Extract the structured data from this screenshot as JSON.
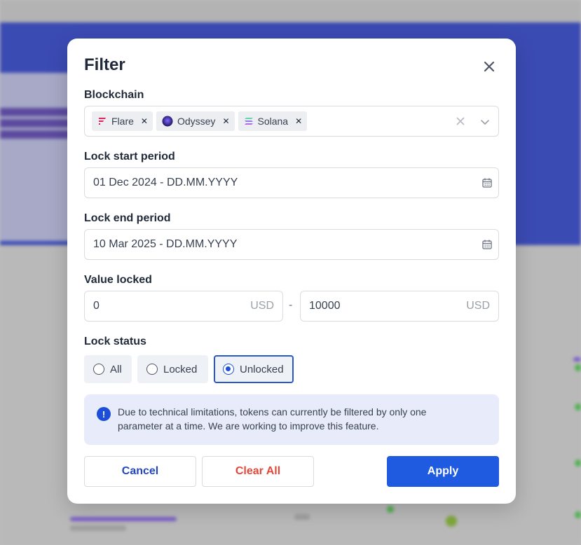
{
  "filter": {
    "title": "Filter",
    "blockchain_label": "Blockchain",
    "chains": [
      {
        "name": "Flare",
        "icon": "flare-logo-icon"
      },
      {
        "name": "Odyssey",
        "icon": "odyssey-logo-icon"
      },
      {
        "name": "Solana",
        "icon": "solana-logo-icon"
      }
    ],
    "lock_start_label": "Lock start period",
    "lock_start_value": "01 Dec 2024 - DD.MM.YYYY",
    "lock_end_label": "Lock end period",
    "lock_end_value": "10 Mar 2025 - DD.MM.YYYY",
    "value_locked_label": "Value locked",
    "value_min": "0",
    "value_max": "10000",
    "unit": "USD",
    "range_separator": "-",
    "lock_status_label": "Lock status",
    "status_options": [
      "All",
      "Locked",
      "Unlocked"
    ],
    "selected_status": "Unlocked",
    "notice": "Due to technical limitations, tokens can currently be filtered by only one parameter at a time. We are working to improve this feature.",
    "cancel_label": "Cancel",
    "clear_all_label": "Clear All",
    "apply_label": "Apply"
  },
  "colors": {
    "primary": "#1e5be0",
    "danger": "#e5483b",
    "notice_bg": "#e8ecfa",
    "backdrop_hero": "#3b4bb4"
  }
}
